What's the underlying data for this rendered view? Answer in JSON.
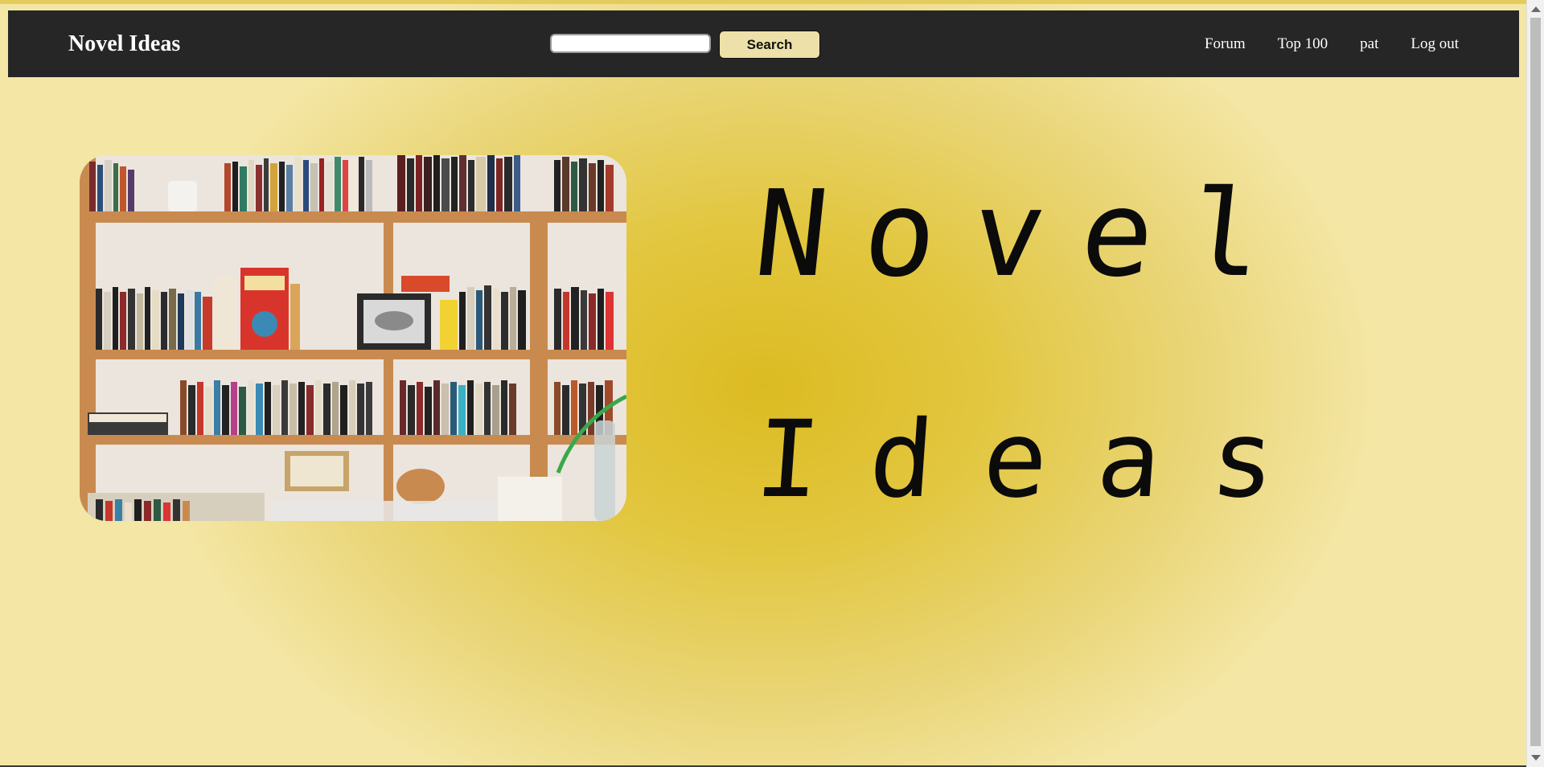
{
  "brand": {
    "title": "Novel Ideas"
  },
  "search": {
    "placeholder": "",
    "value": "",
    "button_label": "Search"
  },
  "nav": {
    "links": [
      "Forum",
      "Top 100",
      "pat",
      "Log out"
    ]
  },
  "hero": {
    "line1": "Novel",
    "line2": "Ideas",
    "image_name": "bookshelf-photo"
  },
  "colors": {
    "navbar_bg": "#262626",
    "page_bg_center": "#dcbb22",
    "page_bg_edge": "#f4e6a4",
    "search_button_bg": "#ede0a8"
  }
}
